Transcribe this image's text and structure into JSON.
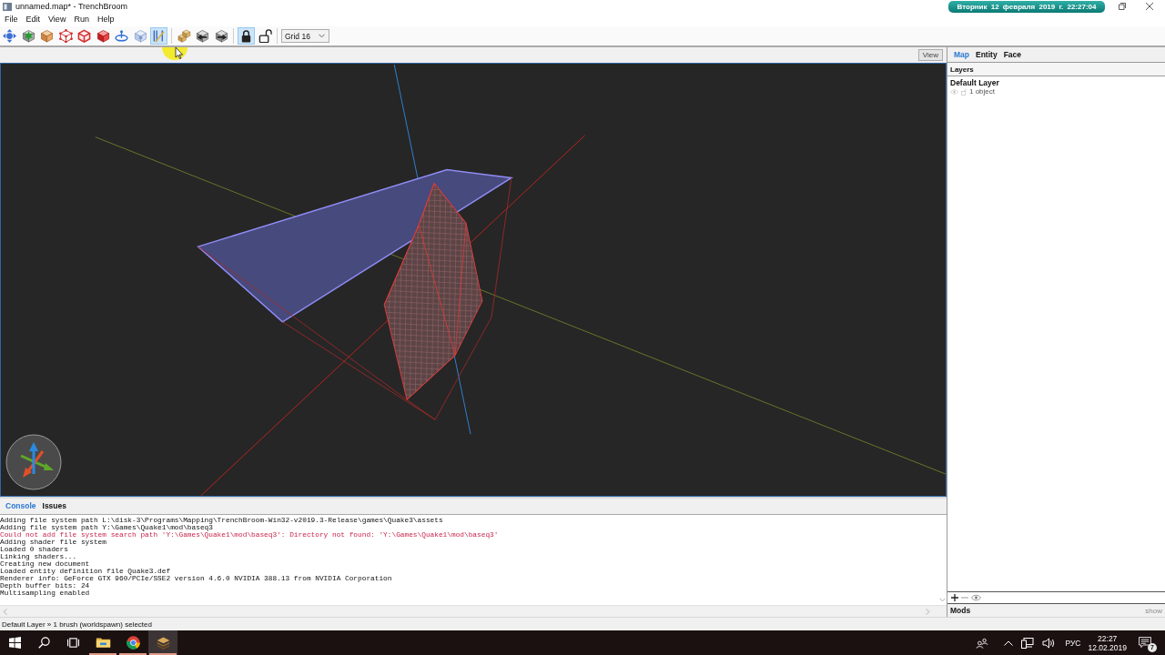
{
  "window": {
    "title": "unnamed.map* - TrenchBroom"
  },
  "date_banner": "Вторник 12 февраля 2019 г. 22:27:04",
  "menu": [
    "File",
    "Edit",
    "View",
    "Run",
    "Help"
  ],
  "toolbar": {
    "groups": [
      [
        {
          "kind": "move",
          "selected": false
        },
        {
          "kind": "burst",
          "selected": false
        },
        {
          "kind": "cube",
          "selected": false
        },
        {
          "kind": "vertex",
          "selected": false
        },
        {
          "kind": "edge",
          "selected": false
        },
        {
          "kind": "face",
          "selected": false
        },
        {
          "kind": "rotate",
          "selected": false
        },
        {
          "kind": "ghost",
          "selected": false
        },
        {
          "kind": "clip",
          "selected": true
        }
      ],
      [
        {
          "kind": "duplicate",
          "selected": false
        },
        {
          "kind": "flipleft",
          "selected": false
        },
        {
          "kind": "flipright",
          "selected": false
        }
      ],
      [
        {
          "kind": "lock",
          "selected": true
        },
        {
          "kind": "unlock",
          "selected": false
        }
      ]
    ],
    "grid": "Grid 16"
  },
  "viewport": {
    "view_button": "View"
  },
  "inspector": {
    "tabs": [
      {
        "label": "Map",
        "selected": true
      },
      {
        "label": "Entity",
        "selected": false
      },
      {
        "label": "Face",
        "selected": false
      }
    ],
    "layers": {
      "title": "Layers",
      "items": [
        {
          "name": "Default Layer",
          "count": "1 object"
        }
      ]
    },
    "mods": {
      "title": "Mods",
      "action": "show"
    }
  },
  "console": {
    "tabs": [
      {
        "label": "Console",
        "selected": true
      },
      {
        "label": "Issues",
        "selected": false
      }
    ],
    "lines": [
      {
        "kind": "info",
        "text": "Adding file system path L:\\disk-3\\Programs\\Mapping\\TrenchBroom-Win32-v2019.3-Release\\games\\Quake3\\assets"
      },
      {
        "kind": "info",
        "text": "Adding file system path Y:\\Games\\Quake1\\mod\\baseq3"
      },
      {
        "kind": "error",
        "text": "Could not add file system search path 'Y:\\Games\\Quake1\\mod\\baseq3': Directory not found: 'Y:\\Games\\Quake1\\mod\\baseq3'"
      },
      {
        "kind": "info",
        "text": "Adding shader file system"
      },
      {
        "kind": "info",
        "text": "Loaded 0 shaders"
      },
      {
        "kind": "info",
        "text": "Linking shaders..."
      },
      {
        "kind": "info",
        "text": "Creating new document"
      },
      {
        "kind": "info",
        "text": "Loaded entity definition file Quake3.def"
      },
      {
        "kind": "info",
        "text": "Renderer info: GeForce GTX 960/PCIe/SSE2 version 4.6.0 NVIDIA 388.13 from NVIDIA Corporation"
      },
      {
        "kind": "info",
        "text": "Depth buffer bits: 24"
      },
      {
        "kind": "info",
        "text": "Multisampling enabled"
      }
    ]
  },
  "status_bar": "Default Layer » 1 brush (worldspawn) selected",
  "taskbar": {
    "apps": [
      {
        "kind": "folder",
        "running": true,
        "active": false
      },
      {
        "kind": "browser",
        "running": true,
        "active": false
      },
      {
        "kind": "app",
        "running": true,
        "active": true
      }
    ],
    "language": "РУС",
    "time": "22:27",
    "date": "12.02.2019",
    "notifications": "7"
  }
}
